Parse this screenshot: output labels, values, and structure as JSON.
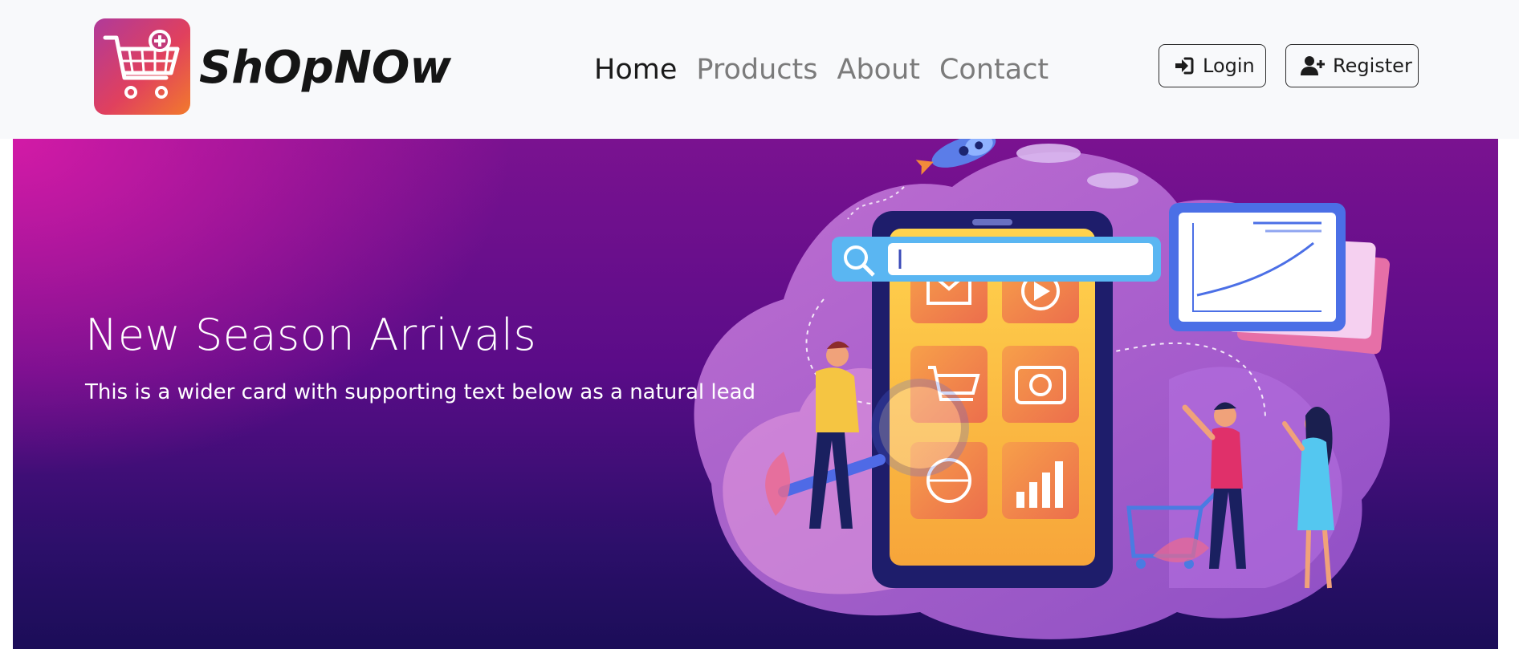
{
  "brand": {
    "name": "ShOpNOw",
    "logo_icon": "shopping-cart-add-icon",
    "logo_colors": [
      "#b03a9a",
      "#e0405e",
      "#f27a2c"
    ]
  },
  "nav": {
    "links": [
      {
        "label": "Home",
        "active": true
      },
      {
        "label": "Products",
        "active": false
      },
      {
        "label": "About",
        "active": false
      },
      {
        "label": "Contact",
        "active": false
      }
    ]
  },
  "auth": {
    "login": {
      "label": "Login",
      "icon": "sign-in-icon"
    },
    "register": {
      "label": "Register",
      "icon": "user-plus-icon"
    }
  },
  "hero": {
    "title": "New Season Arrivals",
    "text": "This is a wider card with supporting text below as a natural lead",
    "illustration": "online-shopping-illustration",
    "colors": {
      "top_left": "#d21aa6",
      "mid": "#5a0c88",
      "bottom": "#1b0d58"
    }
  }
}
